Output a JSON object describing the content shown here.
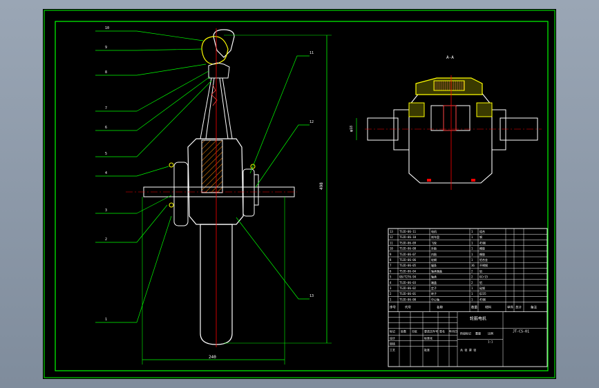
{
  "drawing": {
    "callouts_left": [
      "10",
      "9",
      "8",
      "7",
      "6",
      "5",
      "4",
      "3",
      "2",
      "1"
    ],
    "callouts_right": [
      "11",
      "12",
      "13"
    ],
    "section_label": "A-A",
    "dim_height": "φ18",
    "dim_width": "240",
    "dim_vertical": "498",
    "colors": {
      "frame": "#00ff00",
      "lines": "#ffffff",
      "center": "#ff0000",
      "accent": "#ffff00",
      "leader": "#00ff00"
    }
  },
  "title_block": {
    "title": "轮毂电机",
    "drawing_no": "JT-CS-01",
    "scale": "1:1",
    "header_cells": [
      "序号",
      "代号",
      "名称",
      "数量",
      "材料",
      "单件",
      "总计",
      "备注"
    ],
    "bottom_cells": [
      "标记",
      "处数",
      "分区",
      "更改文件号",
      "签名",
      "年月日",
      "设计",
      "标准化",
      "阶段标记",
      "重量",
      "比例",
      "审核",
      "工艺",
      "批准",
      "共 张 第 张"
    ],
    "parts": [
      {
        "no": "13",
        "code": "TSJD-06-11",
        "name": "电机",
        "qty": "1",
        "mat": "组合"
      },
      {
        "no": "12",
        "code": "TSJD-06-10",
        "name": "刹车盘",
        "qty": "1",
        "mat": "钢"
      },
      {
        "no": "11",
        "code": "TSJD-06-09",
        "name": "飞轮",
        "qty": "1",
        "mat": "45钢"
      },
      {
        "no": "10",
        "code": "TSJD-06-08",
        "name": "外胎",
        "qty": "1",
        "mat": "橡胶"
      },
      {
        "no": "9",
        "code": "TSJD-06-07",
        "name": "内胎",
        "qty": "1",
        "mat": "橡胶"
      },
      {
        "no": "8",
        "code": "TSJD-06-06",
        "name": "轮辋",
        "qty": "1",
        "mat": "铝合金"
      },
      {
        "no": "7",
        "code": "TSJD-06-05",
        "name": "辐条",
        "qty": "36",
        "mat": "不锈钢"
      },
      {
        "no": "6",
        "code": "TSJD-06-04",
        "name": "轴承端盖",
        "qty": "2",
        "mat": "铝"
      },
      {
        "no": "5",
        "code": "GB/T276-94",
        "name": "轴承",
        "qty": "2",
        "mat": "GCr15"
      },
      {
        "no": "4",
        "code": "TSJD-06-03",
        "name": "端盖",
        "qty": "2",
        "mat": "铝"
      },
      {
        "no": "3",
        "code": "TSJD-06-02",
        "name": "定子",
        "qty": "1",
        "mat": "硅钢"
      },
      {
        "no": "2",
        "code": "TSJD-06-01",
        "name": "转子",
        "qty": "1",
        "mat": "Q235"
      },
      {
        "no": "1",
        "code": "TSJD-06-00",
        "name": "中心轴",
        "qty": "1",
        "mat": "45钢"
      }
    ]
  }
}
